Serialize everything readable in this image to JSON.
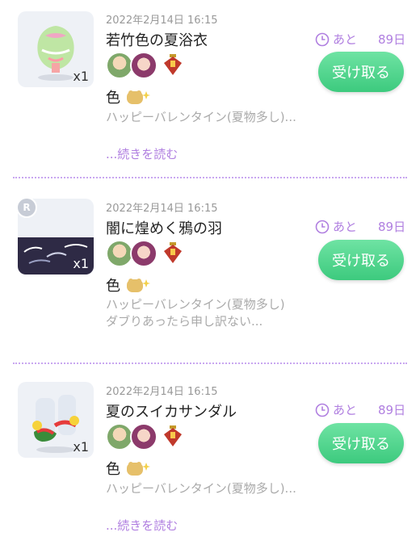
{
  "items": [
    {
      "date": "2022年2月14日 16:15",
      "title": "若竹色の夏浴衣",
      "qty": "x1",
      "color_label": "色",
      "desc": "ハッピーバレンタイン(夏物多し)...",
      "more": "...続きを読む",
      "remain_label": "あと",
      "remain_days": "89日",
      "button": "受け取る"
    },
    {
      "date": "2022年2月14日 16:15",
      "title": "闇に煌めく鴉の羽",
      "qty": "x1",
      "badge": "R",
      "color_label": "色",
      "desc": "ハッピーバレンタイン(夏物多し)\nダブりあったら申し訳ない...",
      "remain_label": "あと",
      "remain_days": "89日",
      "button": "受け取る"
    },
    {
      "date": "2022年2月14日 16:15",
      "title": "夏のスイカサンダル",
      "qty": "x1",
      "color_label": "色",
      "desc": "ハッピーバレンタイン(夏物多し)...",
      "more": "...続きを読む",
      "remain_label": "あと",
      "remain_days": "89日",
      "button": "受け取る"
    }
  ],
  "colors": {
    "accent": "#b07fe0",
    "button": "#3dca7e"
  }
}
